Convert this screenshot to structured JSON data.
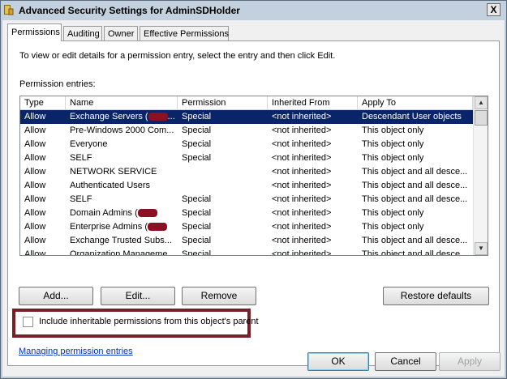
{
  "window": {
    "title": "Advanced Security Settings for AdminSDHolder",
    "close_glyph": "X"
  },
  "tabs": [
    {
      "label": "Permissions",
      "active": true
    },
    {
      "label": "Auditing",
      "active": false
    },
    {
      "label": "Owner",
      "active": false
    },
    {
      "label": "Effective Permissions",
      "active": false
    }
  ],
  "permissions": {
    "instruction": "To view or edit details for a permission entry, select the entry and then click Edit.",
    "entries_label": "Permission entries:",
    "columns": [
      "Type",
      "Name",
      "Permission",
      "Inherited From",
      "Apply To"
    ],
    "rows": [
      {
        "type": "Allow",
        "name": "Exchange Servers (",
        "redacted": true,
        "name_suffix": "...",
        "permission": "Special",
        "inherited": "<not inherited>",
        "apply": "Descendant User objects",
        "selected": true
      },
      {
        "type": "Allow",
        "name": "Pre-Windows 2000 Com...",
        "redacted": false,
        "name_suffix": "",
        "permission": "Special",
        "inherited": "<not inherited>",
        "apply": "This object only",
        "selected": false
      },
      {
        "type": "Allow",
        "name": "Everyone",
        "redacted": false,
        "name_suffix": "",
        "permission": "Special",
        "inherited": "<not inherited>",
        "apply": "This object only",
        "selected": false
      },
      {
        "type": "Allow",
        "name": "SELF",
        "redacted": false,
        "name_suffix": "",
        "permission": "Special",
        "inherited": "<not inherited>",
        "apply": "This object only",
        "selected": false
      },
      {
        "type": "Allow",
        "name": "NETWORK SERVICE",
        "redacted": false,
        "name_suffix": "",
        "permission": "",
        "inherited": "<not inherited>",
        "apply": "This object and all desce...",
        "selected": false
      },
      {
        "type": "Allow",
        "name": "Authenticated Users",
        "redacted": false,
        "name_suffix": "",
        "permission": "",
        "inherited": "<not inherited>",
        "apply": "This object and all desce...",
        "selected": false
      },
      {
        "type": "Allow",
        "name": "SELF",
        "redacted": false,
        "name_suffix": "",
        "permission": "Special",
        "inherited": "<not inherited>",
        "apply": "This object and all desce...",
        "selected": false
      },
      {
        "type": "Allow",
        "name": "Domain Admins (",
        "redacted": true,
        "name_suffix": "",
        "permission": "Special",
        "inherited": "<not inherited>",
        "apply": "This object only",
        "selected": false
      },
      {
        "type": "Allow",
        "name": "Enterprise Admins (",
        "redacted": true,
        "name_suffix": "",
        "permission": "Special",
        "inherited": "<not inherited>",
        "apply": "This object only",
        "selected": false
      },
      {
        "type": "Allow",
        "name": "Exchange Trusted Subs...",
        "redacted": false,
        "name_suffix": "",
        "permission": "Special",
        "inherited": "<not inherited>",
        "apply": "This object and all desce...",
        "selected": false
      },
      {
        "type": "Allow",
        "name": "Organization Manageme...",
        "redacted": false,
        "name_suffix": "",
        "permission": "Special",
        "inherited": "<not inherited>",
        "apply": "This object and all desce...",
        "selected": false
      }
    ],
    "scroll_position": 0.0,
    "buttons": {
      "add": "Add...",
      "edit": "Edit...",
      "remove": "Remove",
      "restore": "Restore defaults"
    },
    "inherit_checkbox": {
      "label": "Include inheritable permissions from this object's parent",
      "checked": false
    },
    "manage_link": "Managing permission entries"
  },
  "footer": {
    "ok": "OK",
    "cancel": "Cancel",
    "apply": "Apply"
  },
  "colors": {
    "selection": "#0a246a",
    "highlight_box": "#7a1e28",
    "redaction": "#8a1122"
  }
}
